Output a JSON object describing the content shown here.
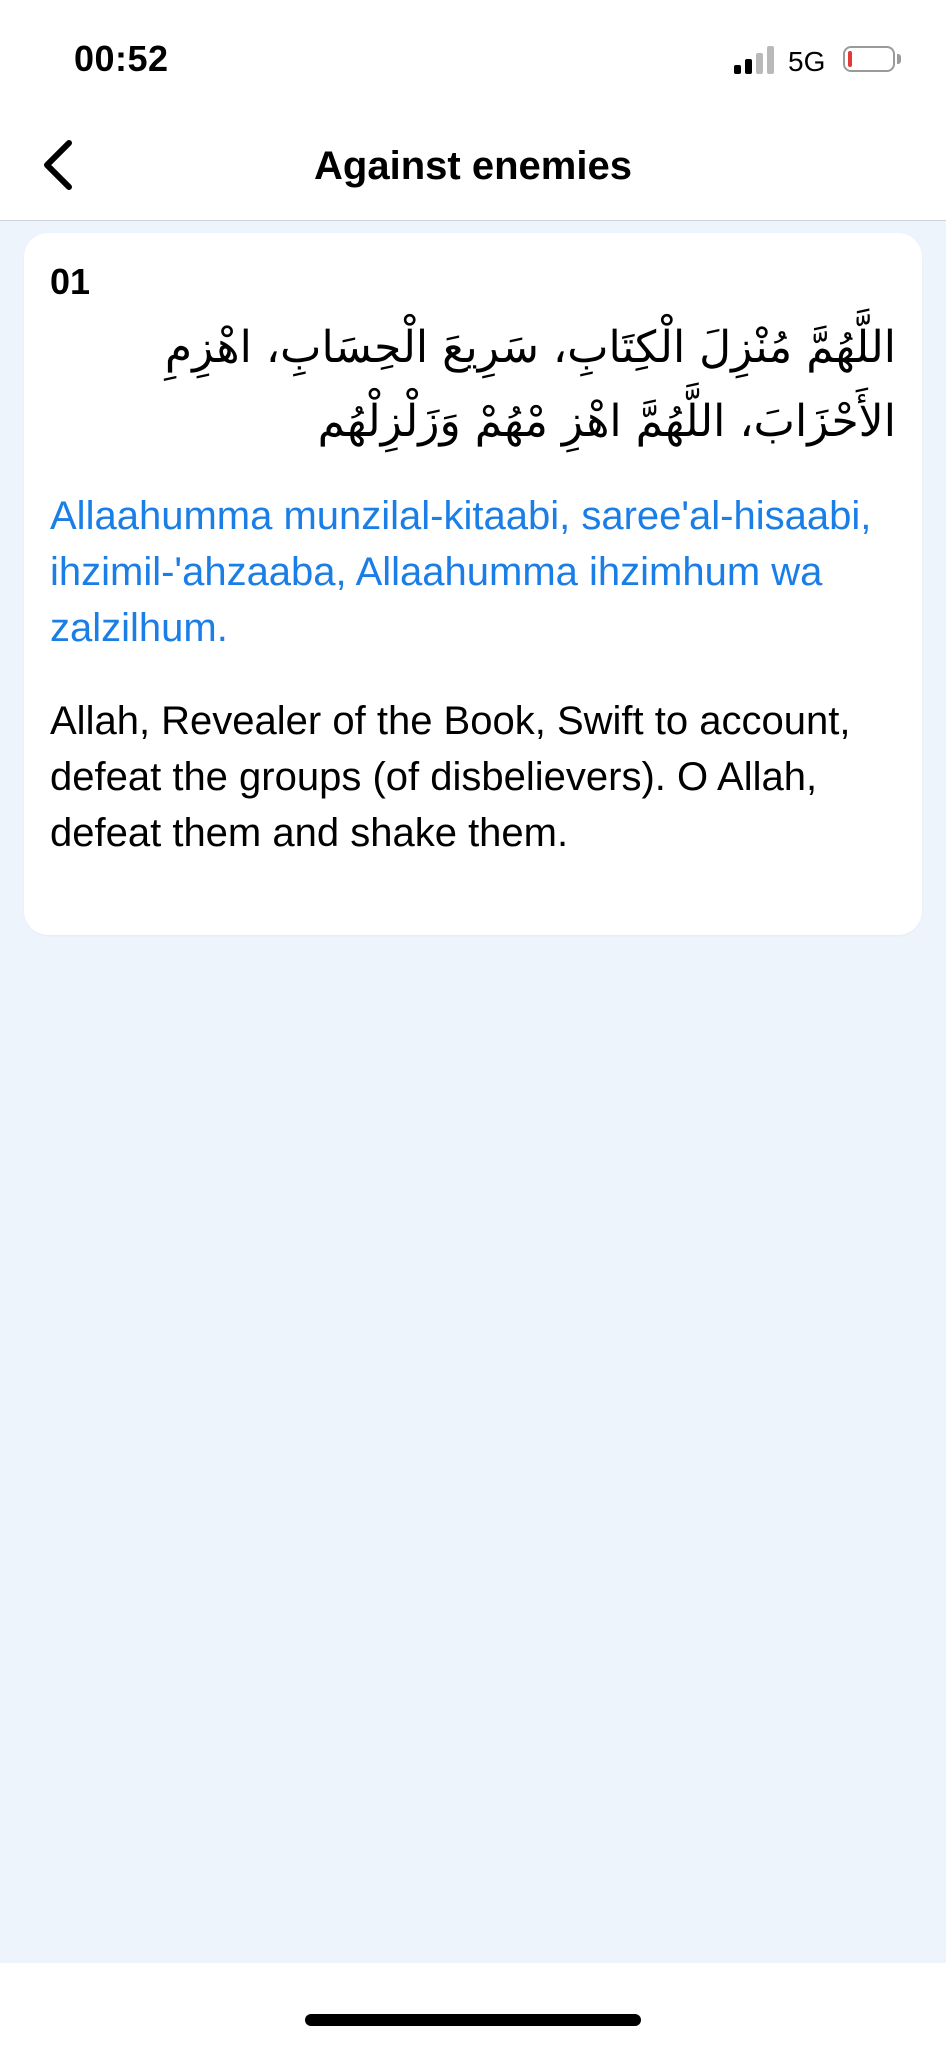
{
  "status_bar": {
    "time": "00:52",
    "network": "5G",
    "signal_bars_active": 2,
    "signal_bars_total": 4,
    "battery_level": 0.05,
    "battery_color": "#e53935"
  },
  "header": {
    "title": "Against enemies"
  },
  "items": [
    {
      "number": "01",
      "arabic": "اللَّهُمَّ مُنْزِلَ الْكِتَابِ، سَرِيعَ الْحِسَابِ، اهْزِمِ الأَحْزَابَ، اللَّهُمَّ اهْزِ مْهُمْ وَزَلْزِلْهُم",
      "transliteration": "Allaahumma munzilal-kitaabi, saree'al-hisaabi, ihzimil-'ahzaaba, Allaahumma ihzimhum wa zalzilhum.",
      "translation": "Allah, Revealer of the Book, Swift to account, defeat the groups (of disbelievers). O Allah, defeat them and shake them."
    }
  ],
  "colors": {
    "accent": "#1a7ee6",
    "background": "#eef4fc",
    "card": "#ffffff",
    "signal_active": "#000000",
    "signal_inactive": "#b9b9b9"
  },
  "icons": {
    "back": "chevron-left-icon",
    "signal": "cellular-signal-icon",
    "battery": "battery-icon"
  }
}
